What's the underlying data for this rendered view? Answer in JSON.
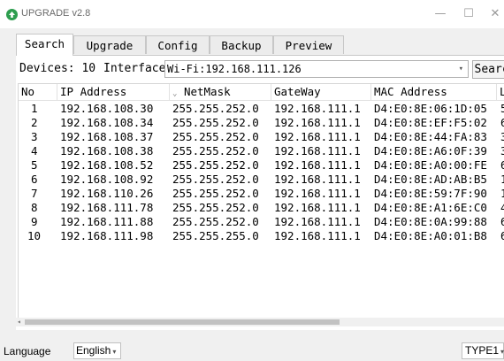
{
  "window": {
    "title": "UPGRADE v2.8",
    "controls": {
      "minimize": "—",
      "maximize": "☐",
      "close": "✕"
    }
  },
  "tabs": [
    {
      "label": "Search",
      "active": true
    },
    {
      "label": "Upgrade",
      "active": false
    },
    {
      "label": "Config",
      "active": false
    },
    {
      "label": "Backup",
      "active": false
    },
    {
      "label": "Preview",
      "active": false
    }
  ],
  "toolbar": {
    "devices_label": "Devices:",
    "devices_count": "10",
    "interface_label": "Interface",
    "interface_value": "Wi-Fi:192.168.111.126",
    "search_label": "Search"
  },
  "table": {
    "columns": [
      "No",
      "IP Address",
      "NetMask",
      "GateWay",
      "MAC Address",
      "L"
    ],
    "rows": [
      [
        "1",
        "192.168.108.30",
        "255.255.252.0",
        "192.168.111.1",
        "D4:E0:8E:06:1D:05",
        "5"
      ],
      [
        "2",
        "192.168.108.34",
        "255.255.252.0",
        "192.168.111.1",
        "D4:E0:8E:EF:F5:02",
        "6"
      ],
      [
        "3",
        "192.168.108.37",
        "255.255.252.0",
        "192.168.111.1",
        "D4:E0:8E:44:FA:83",
        "3"
      ],
      [
        "4",
        "192.168.108.38",
        "255.255.252.0",
        "192.168.111.1",
        "D4:E0:8E:A6:0F:39",
        "3"
      ],
      [
        "5",
        "192.168.108.52",
        "255.255.252.0",
        "192.168.111.1",
        "D4:E0:8E:A0:00:FE",
        "6"
      ],
      [
        "6",
        "192.168.108.92",
        "255.255.252.0",
        "192.168.111.1",
        "D4:E0:8E:AD:AB:B5",
        "1"
      ],
      [
        "7",
        "192.168.110.26",
        "255.255.252.0",
        "192.168.111.1",
        "D4:E0:8E:59:7F:90",
        "1"
      ],
      [
        "8",
        "192.168.111.78",
        "255.255.252.0",
        "192.168.111.1",
        "D4:E0:8E:A1:6E:C0",
        "4"
      ],
      [
        "9",
        "192.168.111.88",
        "255.255.252.0",
        "192.168.111.1",
        "D4:E0:8E:0A:99:88",
        "6"
      ],
      [
        "10",
        "192.168.111.98",
        "255.255.255.0",
        "192.168.111.1",
        "D4:E0:8E:A0:01:B8",
        "6"
      ]
    ]
  },
  "status": {
    "language_label": "Language",
    "language_value": "English",
    "type_value": "TYPE1"
  },
  "colors": {
    "app_icon": "#2e9e4f"
  }
}
